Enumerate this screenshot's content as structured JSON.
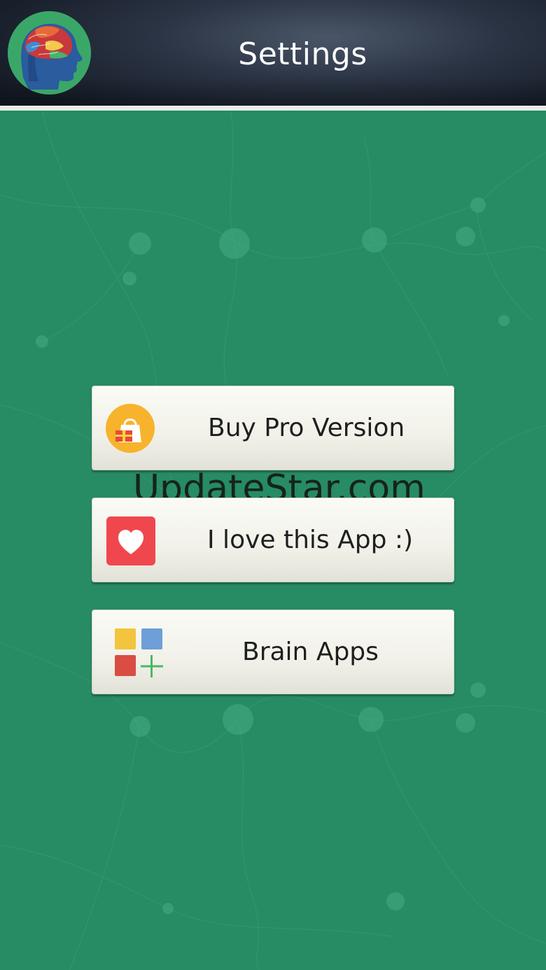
{
  "header": {
    "title": "Settings",
    "logo_icon": "brain-head-icon",
    "logo_bg_color": "#3aa769"
  },
  "menu": [
    {
      "label": "Buy Pro Version",
      "icon": "shopping-bag-icon"
    },
    {
      "label": "I love this App :)",
      "icon": "heart-icon"
    },
    {
      "label": "Brain Apps",
      "icon": "apps-grid-plus-icon"
    }
  ],
  "watermark": "UpdateStar.com",
  "colors": {
    "background": "#288a63",
    "header_dark": "#1d2430",
    "button_face": "#f4f4ee",
    "heart_red": "#f0474e",
    "bag_orange": "#f7b32c"
  }
}
